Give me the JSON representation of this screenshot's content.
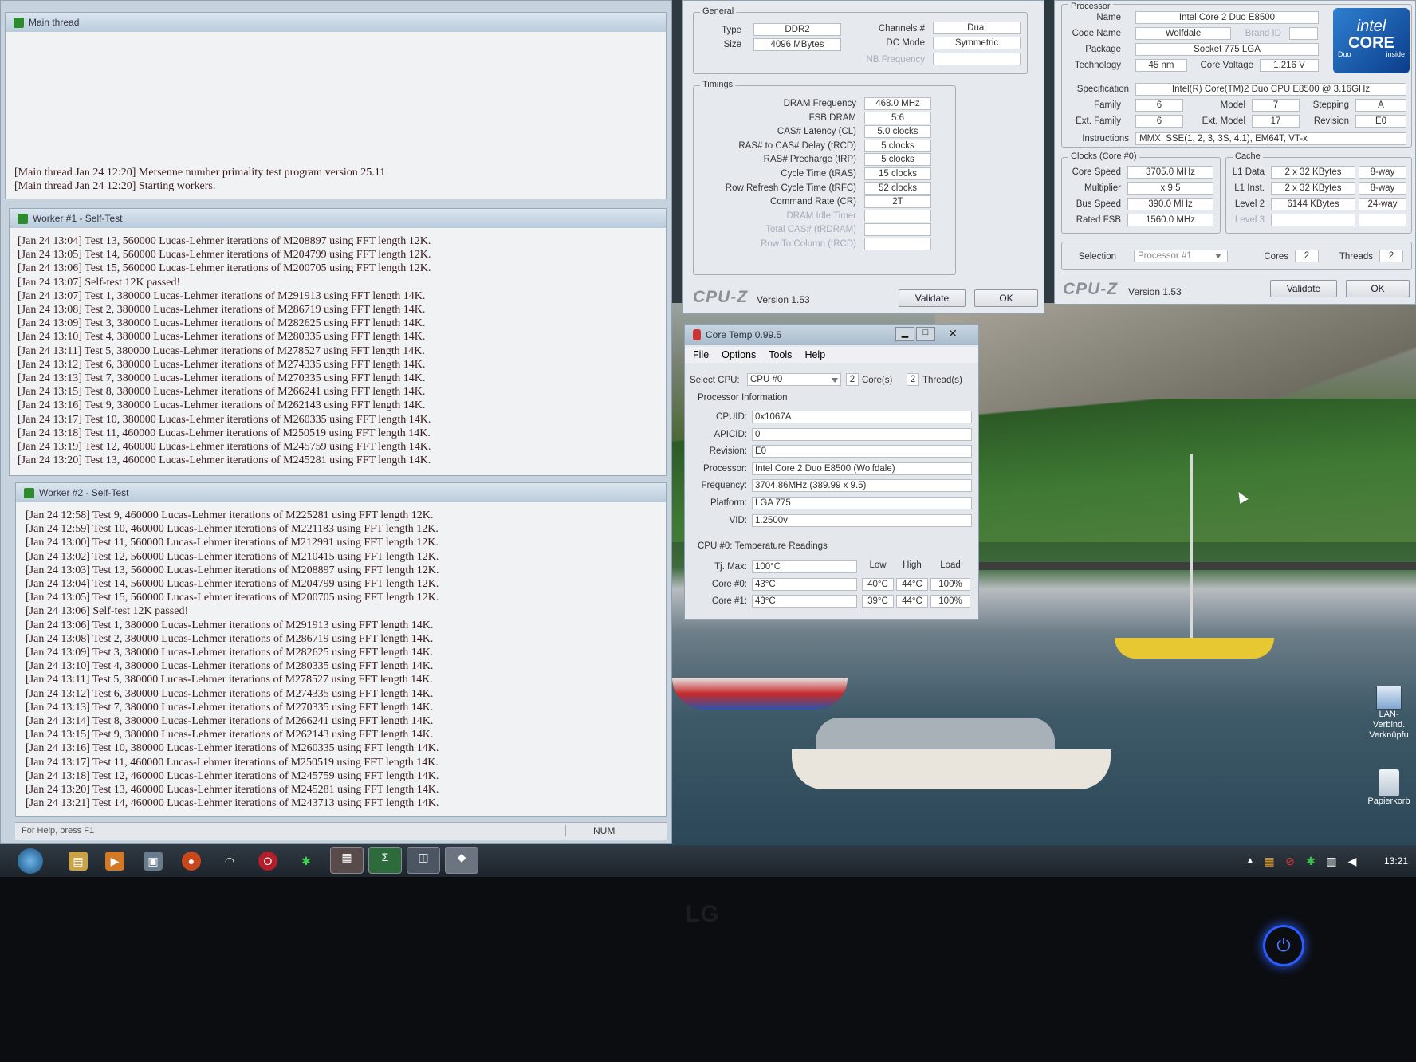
{
  "prime95": {
    "main_thread": {
      "title": "Main thread",
      "lines": [
        "[Main thread Jan 24 12:20] Mersenne number primality test program version 25.11",
        "[Main thread Jan 24 12:20] Starting workers."
      ]
    },
    "worker1": {
      "title": "Worker #1 - Self-Test",
      "lines": [
        "[Jan 24 13:04] Test 13, 560000 Lucas-Lehmer iterations of M208897 using FFT length 12K.",
        "[Jan 24 13:05] Test 14, 560000 Lucas-Lehmer iterations of M204799 using FFT length 12K.",
        "[Jan 24 13:06] Test 15, 560000 Lucas-Lehmer iterations of M200705 using FFT length 12K.",
        "[Jan 24 13:07] Self-test 12K passed!",
        "[Jan 24 13:07] Test 1, 380000 Lucas-Lehmer iterations of M291913 using FFT length 14K.",
        "[Jan 24 13:08] Test 2, 380000 Lucas-Lehmer iterations of M286719 using FFT length 14K.",
        "[Jan 24 13:09] Test 3, 380000 Lucas-Lehmer iterations of M282625 using FFT length 14K.",
        "[Jan 24 13:10] Test 4, 380000 Lucas-Lehmer iterations of M280335 using FFT length 14K.",
        "[Jan 24 13:11] Test 5, 380000 Lucas-Lehmer iterations of M278527 using FFT length 14K.",
        "[Jan 24 13:12] Test 6, 380000 Lucas-Lehmer iterations of M274335 using FFT length 14K.",
        "[Jan 24 13:13] Test 7, 380000 Lucas-Lehmer iterations of M270335 using FFT length 14K.",
        "[Jan 24 13:15] Test 8, 380000 Lucas-Lehmer iterations of M266241 using FFT length 14K.",
        "[Jan 24 13:16] Test 9, 380000 Lucas-Lehmer iterations of M262143 using FFT length 14K.",
        "[Jan 24 13:17] Test 10, 380000 Lucas-Lehmer iterations of M260335 using FFT length 14K.",
        "[Jan 24 13:18] Test 11, 460000 Lucas-Lehmer iterations of M250519 using FFT length 14K.",
        "[Jan 24 13:19] Test 12, 460000 Lucas-Lehmer iterations of M245759 using FFT length 14K.",
        "[Jan 24 13:20] Test 13, 460000 Lucas-Lehmer iterations of M245281 using FFT length 14K."
      ]
    },
    "worker2": {
      "title": "Worker #2 - Self-Test",
      "lines": [
        "[Jan 24 12:58] Test 9, 460000 Lucas-Lehmer iterations of M225281 using FFT length 12K.",
        "[Jan 24 12:59] Test 10, 460000 Lucas-Lehmer iterations of M221183 using FFT length 12K.",
        "[Jan 24 13:00] Test 11, 560000 Lucas-Lehmer iterations of M212991 using FFT length 12K.",
        "[Jan 24 13:02] Test 12, 560000 Lucas-Lehmer iterations of M210415 using FFT length 12K.",
        "[Jan 24 13:03] Test 13, 560000 Lucas-Lehmer iterations of M208897 using FFT length 12K.",
        "[Jan 24 13:04] Test 14, 560000 Lucas-Lehmer iterations of M204799 using FFT length 12K.",
        "[Jan 24 13:05] Test 15, 560000 Lucas-Lehmer iterations of M200705 using FFT length 12K.",
        "[Jan 24 13:06] Self-test 12K passed!",
        "[Jan 24 13:06] Test 1, 380000 Lucas-Lehmer iterations of M291913 using FFT length 14K.",
        "[Jan 24 13:08] Test 2, 380000 Lucas-Lehmer iterations of M286719 using FFT length 14K.",
        "[Jan 24 13:09] Test 3, 380000 Lucas-Lehmer iterations of M282625 using FFT length 14K.",
        "[Jan 24 13:10] Test 4, 380000 Lucas-Lehmer iterations of M280335 using FFT length 14K.",
        "[Jan 24 13:11] Test 5, 380000 Lucas-Lehmer iterations of M278527 using FFT length 14K.",
        "[Jan 24 13:12] Test 6, 380000 Lucas-Lehmer iterations of M274335 using FFT length 14K.",
        "[Jan 24 13:13] Test 7, 380000 Lucas-Lehmer iterations of M270335 using FFT length 14K.",
        "[Jan 24 13:14] Test 8, 380000 Lucas-Lehmer iterations of M266241 using FFT length 14K.",
        "[Jan 24 13:15] Test 9, 380000 Lucas-Lehmer iterations of M262143 using FFT length 14K.",
        "[Jan 24 13:16] Test 10, 380000 Lucas-Lehmer iterations of M260335 using FFT length 14K.",
        "[Jan 24 13:17] Test 11, 460000 Lucas-Lehmer iterations of M250519 using FFT length 14K.",
        "[Jan 24 13:18] Test 12, 460000 Lucas-Lehmer iterations of M245759 using FFT length 14K.",
        "[Jan 24 13:20] Test 13, 460000 Lucas-Lehmer iterations of M245281 using FFT length 14K.",
        "[Jan 24 13:21] Test 14, 460000 Lucas-Lehmer iterations of M243713 using FFT length 14K."
      ]
    },
    "status": {
      "help": "For Help, press F1",
      "num": "NUM"
    }
  },
  "cpuz_memory": {
    "general_label": "General",
    "type_label": "Type",
    "type": "DDR2",
    "size_label": "Size",
    "size": "4096 MBytes",
    "channels_label": "Channels #",
    "channels": "Dual",
    "dcmode_label": "DC Mode",
    "dcmode": "Symmetric",
    "nbfreq_label": "NB Frequency",
    "nbfreq": "",
    "timings_label": "Timings",
    "timings": [
      {
        "label": "DRAM Frequency",
        "value": "468.0 MHz",
        "dim": false
      },
      {
        "label": "FSB:DRAM",
        "value": "5:6",
        "dim": false
      },
      {
        "label": "CAS# Latency (CL)",
        "value": "5.0 clocks",
        "dim": false
      },
      {
        "label": "RAS# to CAS# Delay (tRCD)",
        "value": "5 clocks",
        "dim": false
      },
      {
        "label": "RAS# Precharge (tRP)",
        "value": "5 clocks",
        "dim": false
      },
      {
        "label": "Cycle Time (tRAS)",
        "value": "15 clocks",
        "dim": false
      },
      {
        "label": "Row Refresh Cycle Time (tRFC)",
        "value": "52 clocks",
        "dim": false
      },
      {
        "label": "Command Rate (CR)",
        "value": "2T",
        "dim": false
      },
      {
        "label": "DRAM Idle Timer",
        "value": "",
        "dim": true
      },
      {
        "label": "Total CAS# (tRDRAM)",
        "value": "",
        "dim": true
      },
      {
        "label": "Row To Column (tRCD)",
        "value": "",
        "dim": true
      }
    ],
    "logo": "CPU-Z",
    "version": "Version 1.53",
    "validate": "Validate",
    "ok": "OK"
  },
  "cpuz_cpu": {
    "processor_label": "Processor",
    "name_label": "Name",
    "name": "Intel Core 2 Duo E8500",
    "codename_label": "Code Name",
    "codename": "Wolfdale",
    "brandid_label": "Brand ID",
    "package_label": "Package",
    "package": "Socket 775 LGA",
    "technology_label": "Technology",
    "technology": "45 nm",
    "corevoltage_label": "Core Voltage",
    "corevoltage": "1.216 V",
    "spec_label": "Specification",
    "spec": "Intel(R) Core(TM)2 Duo CPU     E8500  @ 3.16GHz",
    "family_label": "Family",
    "family": "6",
    "model_label": "Model",
    "model": "7",
    "stepping_label": "Stepping",
    "stepping": "A",
    "extfamily_label": "Ext. Family",
    "extfamily": "6",
    "extmodel_label": "Ext. Model",
    "extmodel": "17",
    "revision_label": "Revision",
    "revision": "E0",
    "instructions_label": "Instructions",
    "instructions": "MMX, SSE(1, 2, 3, 3S, 4.1), EM64T, VT-x",
    "clocks_label": "Clocks (Core #0)",
    "corespeed_label": "Core Speed",
    "corespeed": "3705.0 MHz",
    "multiplier_label": "Multiplier",
    "multiplier": "x 9.5",
    "busspeed_label": "Bus Speed",
    "busspeed": "390.0 MHz",
    "ratedfsb_label": "Rated FSB",
    "ratedfsb": "1560.0 MHz",
    "cache_label": "Cache",
    "l1data_label": "L1 Data",
    "l1data": "2 x 32 KBytes",
    "l1data_way": "8-way",
    "l1inst_label": "L1 Inst.",
    "l1inst": "2 x 32 KBytes",
    "l1inst_way": "8-way",
    "level2_label": "Level 2",
    "level2": "6144 KBytes",
    "level2_way": "24-way",
    "level3_label": "Level 3",
    "selection_label": "Selection",
    "selection": "Processor #1",
    "cores_label": "Cores",
    "cores": "2",
    "threads_label": "Threads",
    "threads": "2",
    "badge_brand": "intel",
    "badge_core": "CORE",
    "badge_duo": "Duo",
    "badge_inside": "inside",
    "logo": "CPU-Z",
    "version": "Version 1.53",
    "validate": "Validate",
    "ok": "OK"
  },
  "coretemp": {
    "title": "Core Temp 0.99.5",
    "menu": [
      "File",
      "Options",
      "Tools",
      "Help"
    ],
    "select_cpu_label": "Select CPU:",
    "select_cpu": "CPU #0",
    "cores_count": "2",
    "cores_label": "Core(s)",
    "threads_count": "2",
    "threads_label": "Thread(s)",
    "proc_info_label": "Processor Information",
    "info": [
      {
        "label": "CPUID:",
        "value": "0x1067A"
      },
      {
        "label": "APICID:",
        "value": "0"
      },
      {
        "label": "Revision:",
        "value": "E0"
      },
      {
        "label": "Processor:",
        "value": "Intel Core 2 Duo E8500 (Wolfdale)"
      },
      {
        "label": "Frequency:",
        "value": "3704.86MHz (389.99 x 9.5)"
      },
      {
        "label": "Platform:",
        "value": "LGA 775"
      },
      {
        "label": "VID:",
        "value": "1.2500v"
      }
    ],
    "temp_label": "CPU #0: Temperature Readings",
    "col_low": "Low",
    "col_high": "High",
    "col_load": "Load",
    "tjmax_label": "Tj. Max:",
    "tjmax": "100°C",
    "cores": [
      {
        "label": "Core #0:",
        "temp": "43°C",
        "low": "40°C",
        "high": "44°C",
        "load": "100%"
      },
      {
        "label": "Core #1:",
        "temp": "43°C",
        "low": "39°C",
        "high": "44°C",
        "load": "100%"
      }
    ]
  },
  "desktop": {
    "icons": [
      {
        "label": "LAN-Verbind. Verknüpfu",
        "icon": "network-icon"
      },
      {
        "label": "Papierkorb",
        "icon": "recycle-bin-icon"
      }
    ],
    "clock": "13:21",
    "monitor_brand": "LG"
  }
}
